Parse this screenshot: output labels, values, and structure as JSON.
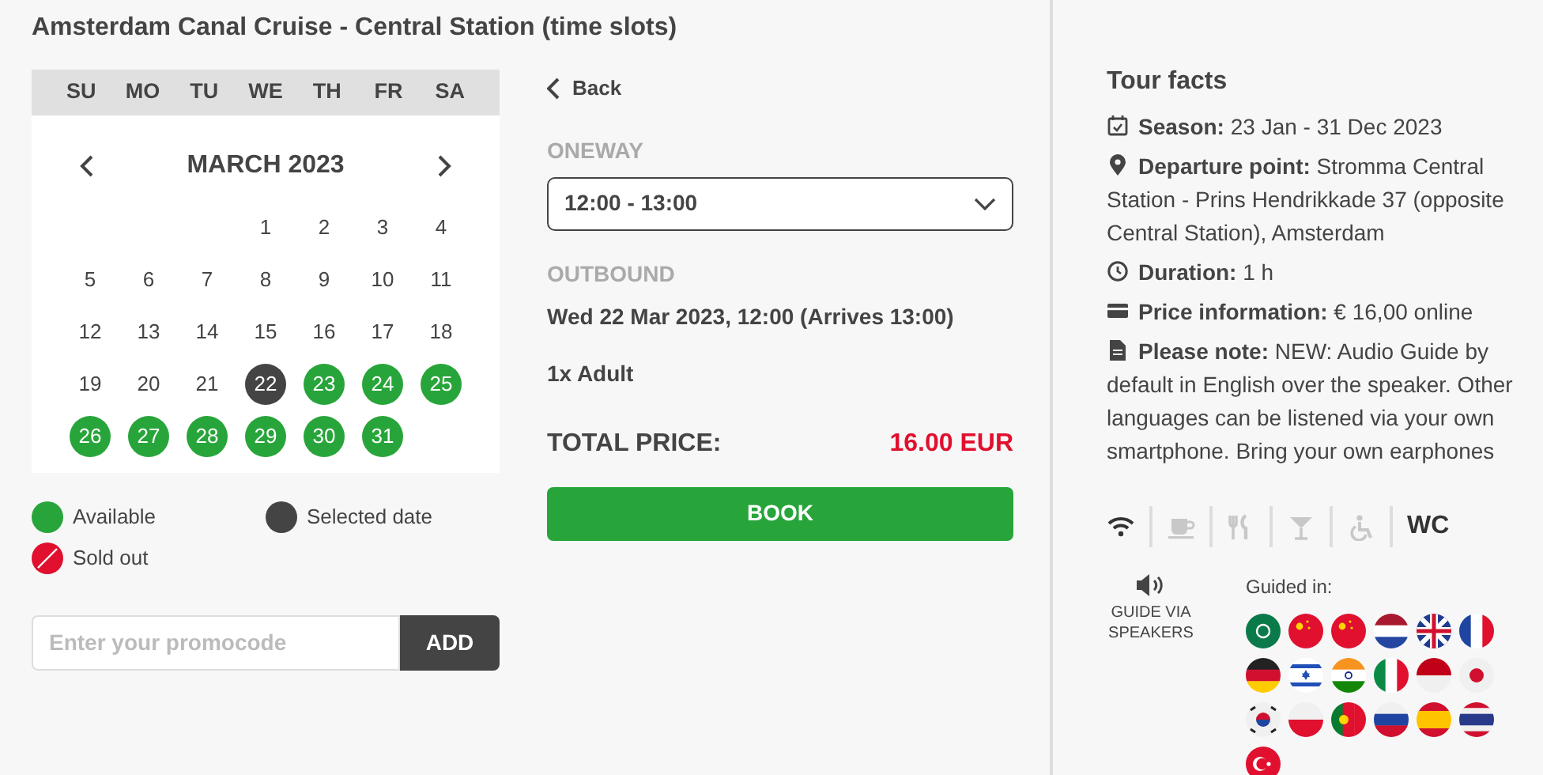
{
  "title": "Amsterdam Canal Cruise - Central Station (time slots)",
  "calendar": {
    "weekdays": [
      "SU",
      "MO",
      "TU",
      "WE",
      "TH",
      "FR",
      "SA"
    ],
    "month": "MARCH 2023",
    "weeks": [
      [
        {
          "kind": "empty"
        },
        {
          "kind": "empty"
        },
        {
          "kind": "empty"
        },
        {
          "label": "1",
          "kind": "plain"
        },
        {
          "label": "2",
          "kind": "plain"
        },
        {
          "label": "3",
          "kind": "plain"
        },
        {
          "label": "4",
          "kind": "plain"
        }
      ],
      [
        {
          "label": "5",
          "kind": "plain"
        },
        {
          "label": "6",
          "kind": "plain"
        },
        {
          "label": "7",
          "kind": "plain"
        },
        {
          "label": "8",
          "kind": "plain"
        },
        {
          "label": "9",
          "kind": "plain"
        },
        {
          "label": "10",
          "kind": "plain"
        },
        {
          "label": "11",
          "kind": "plain"
        }
      ],
      [
        {
          "label": "12",
          "kind": "plain"
        },
        {
          "label": "13",
          "kind": "plain"
        },
        {
          "label": "14",
          "kind": "plain"
        },
        {
          "label": "15",
          "kind": "plain"
        },
        {
          "label": "16",
          "kind": "plain"
        },
        {
          "label": "17",
          "kind": "plain"
        },
        {
          "label": "18",
          "kind": "plain"
        }
      ],
      [
        {
          "label": "19",
          "kind": "plain"
        },
        {
          "label": "20",
          "kind": "plain"
        },
        {
          "label": "21",
          "kind": "plain"
        },
        {
          "label": "22",
          "kind": "selected"
        },
        {
          "label": "23",
          "kind": "available"
        },
        {
          "label": "24",
          "kind": "available"
        },
        {
          "label": "25",
          "kind": "available"
        }
      ],
      [
        {
          "label": "26",
          "kind": "available"
        },
        {
          "label": "27",
          "kind": "available"
        },
        {
          "label": "28",
          "kind": "available"
        },
        {
          "label": "29",
          "kind": "available"
        },
        {
          "label": "30",
          "kind": "available"
        },
        {
          "label": "31",
          "kind": "available"
        },
        {
          "kind": "empty"
        }
      ]
    ]
  },
  "legend": [
    {
      "kind": "available",
      "label": "Available"
    },
    {
      "kind": "selected",
      "label": "Selected date"
    },
    {
      "kind": "soldout",
      "label": "Sold out"
    }
  ],
  "promo": {
    "placeholder": "Enter your promocode",
    "button": "ADD"
  },
  "booking": {
    "back": "Back",
    "trip_label": "ONEWAY",
    "time_slot": "12:00 - 13:00",
    "outbound_label": "OUTBOUND",
    "outbound": "Wed 22 Mar 2023, 12:00 (Arrives 13:00)",
    "passengers": "1x Adult",
    "total_label": "TOTAL PRICE:",
    "total": "16.00 EUR",
    "book": "BOOK"
  },
  "tour_facts": {
    "title": "Tour facts",
    "items": [
      {
        "kind": "calendar",
        "label": "Season:",
        "text": "23 Jan - 31 Dec 2023"
      },
      {
        "kind": "pin",
        "label": "Departure point:",
        "text": "Stromma Central Station - Prins Hendrikkade 37 (opposite Central Station), Amsterdam"
      },
      {
        "kind": "clock",
        "label": "Duration:",
        "text": "1 h"
      },
      {
        "kind": "card",
        "label": "Price information:",
        "text": "€ 16,00 online"
      },
      {
        "kind": "document",
        "label": "Please note:",
        "text": "NEW: Audio Guide by default in English over the speaker. Other languages can be listened via your own smartphone. Bring your own earphones"
      }
    ]
  },
  "amenities": [
    {
      "kind": "wifi",
      "available": true
    },
    {
      "kind": "cup",
      "available": false
    },
    {
      "kind": "cutlery",
      "available": false
    },
    {
      "kind": "glass",
      "available": false
    },
    {
      "kind": "wheelchair",
      "available": false
    },
    {
      "kind": "text",
      "label": "WC",
      "available": true
    }
  ],
  "guide": {
    "label": "GUIDE VIA SPEAKERS",
    "guided_in_label": "Guided in:",
    "flags": [
      {
        "kind": "sa"
      },
      {
        "kind": "cn"
      },
      {
        "kind": "cn"
      },
      {
        "kind": "nl"
      },
      {
        "kind": "gb"
      },
      {
        "kind": "fr"
      },
      {
        "kind": "de"
      },
      {
        "kind": "il"
      },
      {
        "kind": "in"
      },
      {
        "kind": "it"
      },
      {
        "kind": "id"
      },
      {
        "kind": "jp"
      },
      {
        "kind": "kr"
      },
      {
        "kind": "pl"
      },
      {
        "kind": "pt"
      },
      {
        "kind": "ru"
      },
      {
        "kind": "es"
      },
      {
        "kind": "th"
      },
      {
        "kind": "tr"
      }
    ]
  }
}
